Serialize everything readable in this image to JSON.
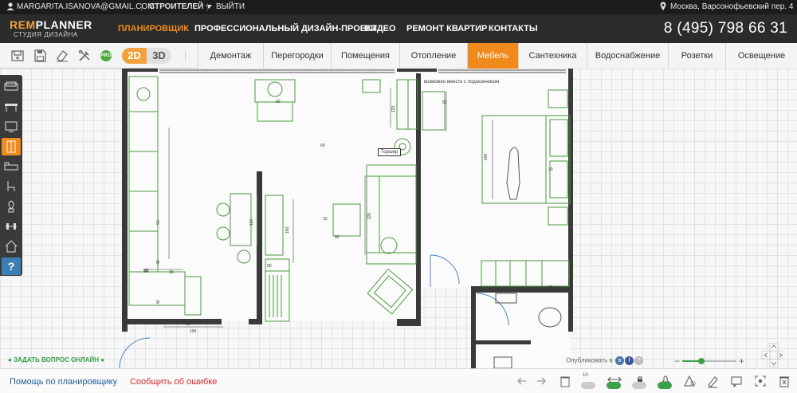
{
  "account": {
    "email": "MARGARITA.ISANOVA@GMAIL.COM",
    "role_label": "СТРОИТЕЛЕЙ",
    "logout_label": "ВЫЙТИ",
    "location": "Москва, Варсонофьевский пер. 4"
  },
  "brand": {
    "logo_text_a": "REM",
    "logo_text_b": "PLANNER",
    "logo_subtitle": "СТУДИЯ ДИЗАЙНА",
    "phone": "8 (495) 798 66 31",
    "accent_color": "#f08a1c",
    "green_color": "#3aa14a"
  },
  "nav": [
    {
      "label": "ПЛАНИРОВЩИК",
      "active": true
    },
    {
      "label": "ПРОФЕССИОНАЛЬНЫЙ ДИЗАЙН-ПРОЕКТ",
      "active": false
    },
    {
      "label": "ВИДЕО",
      "active": false
    },
    {
      "label": "РЕМОНТ КВАРТИР",
      "active": false
    },
    {
      "label": "КОНТАКТЫ",
      "active": false
    }
  ],
  "toolbar": {
    "tools": [
      "save-icon",
      "floppy-icon",
      "eraser-icon",
      "tools-icon"
    ],
    "pro_label": "PRO",
    "mode_2d": "2D",
    "mode_3d": "3D",
    "active_mode": "2D"
  },
  "categories": [
    {
      "label": "Демонтаж",
      "active": false
    },
    {
      "label": "Перегородки",
      "active": false
    },
    {
      "label": "Помещения",
      "active": false
    },
    {
      "label": "Отопление",
      "active": false
    },
    {
      "label": "Мебель",
      "active": true
    },
    {
      "label": "Сантехника",
      "active": false
    },
    {
      "label": "Водоснабжение",
      "active": false
    },
    {
      "label": "Розетки",
      "active": false
    },
    {
      "label": "Освещение",
      "active": false
    }
  ],
  "palette": [
    "sofa-icon",
    "table-icon",
    "tv-icon",
    "wardrobe-icon",
    "bed-icon",
    "chair-icon",
    "plant-icon",
    "gym-icon",
    "house-icon",
    "help-icon"
  ],
  "palette_active": "wardrobe-icon",
  "palette_help_label": "?",
  "plan_labels": {
    "note": "возможно вместе с подоконником",
    "lamp": "Торшер",
    "dims": [
      "120",
      "60",
      "200",
      "220",
      "150",
      "90",
      "100",
      "60",
      "50",
      "120",
      "30",
      "50",
      "42",
      "40",
      "80",
      "61",
      "10",
      "90",
      "50",
      "30",
      "40"
    ]
  },
  "overlay": {
    "ask_label": "ЗАДАТЬ ВОПРОС ОНЛАЙН",
    "share_label": "Опубликовать в",
    "share_networks": [
      "vk-icon",
      "facebook-icon",
      "help-icon"
    ]
  },
  "bottom": {
    "help_link": "Помощь по планировщику",
    "report_link": "Сообщить об ошибке",
    "report_color": "#d22b2b",
    "help_color": "#1f5c99",
    "toggle_tools": [
      "undo-icon",
      "redo-icon",
      "trash-icon",
      "angle-icon",
      "width-icon",
      "lock-icon",
      "bell-icon",
      "area-icon",
      "pencil-icon",
      "chat-icon",
      "select-icon",
      "expand-icon",
      "clear-icon"
    ],
    "toggle_badges": [
      "10",
      "10"
    ]
  }
}
